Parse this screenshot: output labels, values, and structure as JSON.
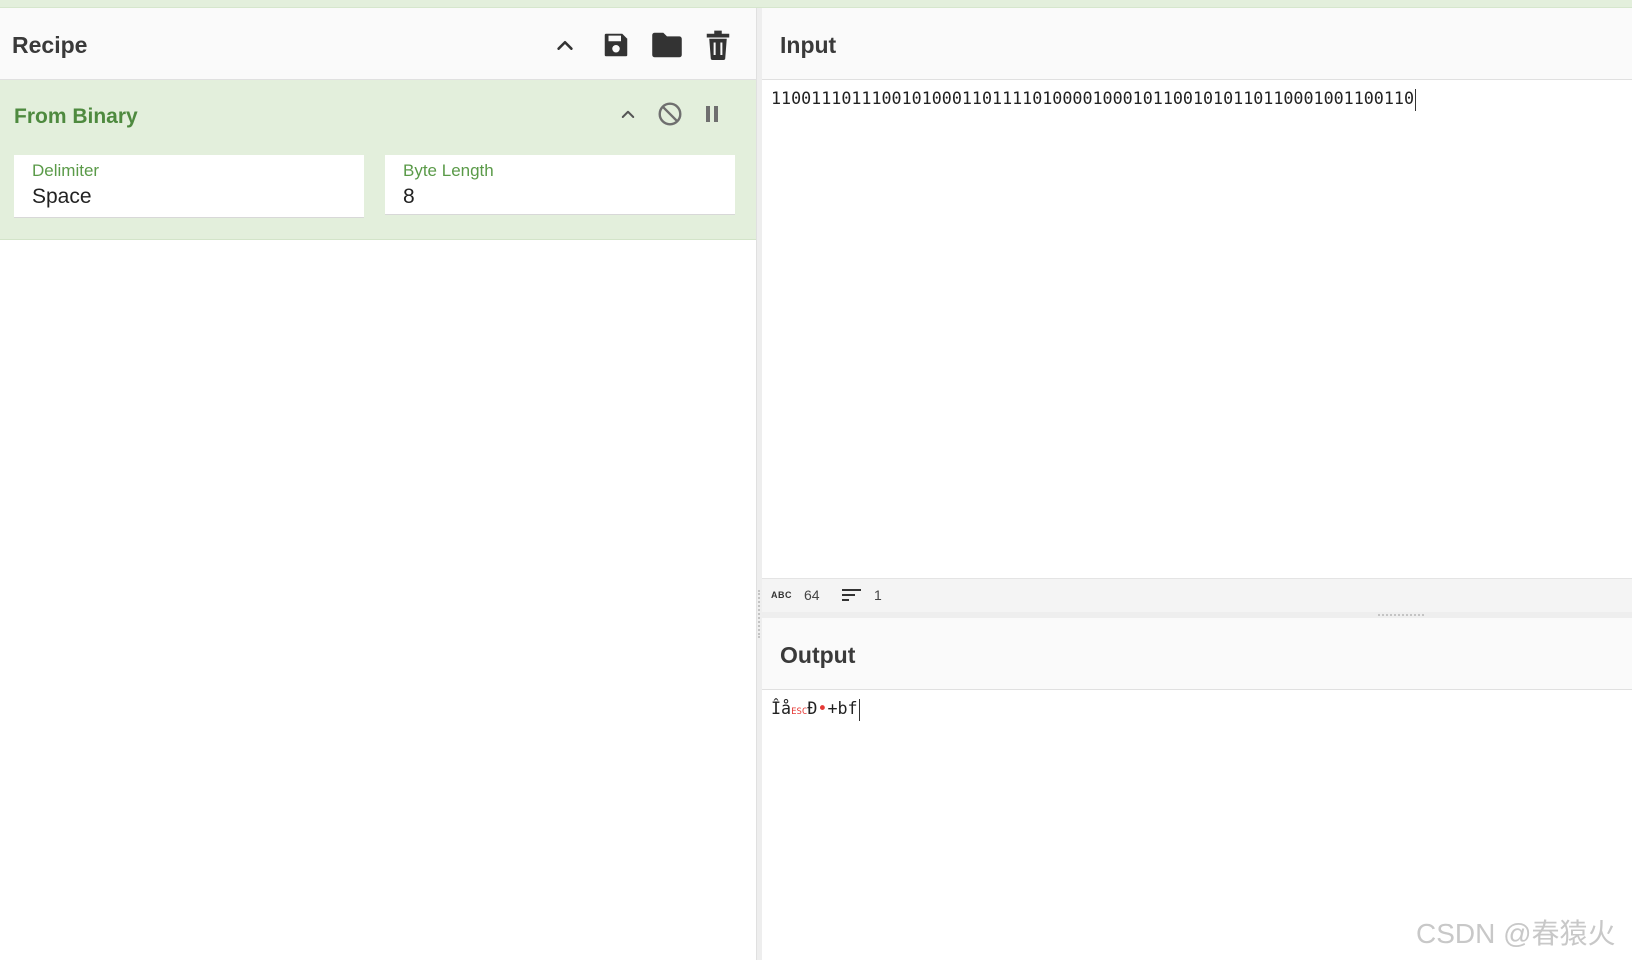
{
  "recipe": {
    "title": "Recipe",
    "operation": {
      "title": "From Binary",
      "args": [
        {
          "label": "Delimiter",
          "value": "Space"
        },
        {
          "label": "Byte Length",
          "value": "8"
        }
      ]
    }
  },
  "input": {
    "title": "Input",
    "value": "1100111011100101000110111101000010001011001010110110001001100110"
  },
  "status": {
    "length_icon": "ABC",
    "length": "64",
    "lines": "1"
  },
  "output": {
    "title": "Output",
    "part1": "Îå",
    "esc": "ESC",
    "part2": "Ð",
    "part3": "+bf"
  },
  "watermark": "CSDN @春猿火",
  "icons": {
    "collapse": "chevron-up-icon",
    "save": "save-icon",
    "load": "folder-icon",
    "clear": "trash-icon",
    "disable": "disable-icon",
    "breakpoint": "pause-icon",
    "lines": "lines-icon"
  },
  "colors": {
    "operation_bg": "#e3efdc",
    "operation_title": "#4e8a3f",
    "control_char": "#e53935"
  }
}
